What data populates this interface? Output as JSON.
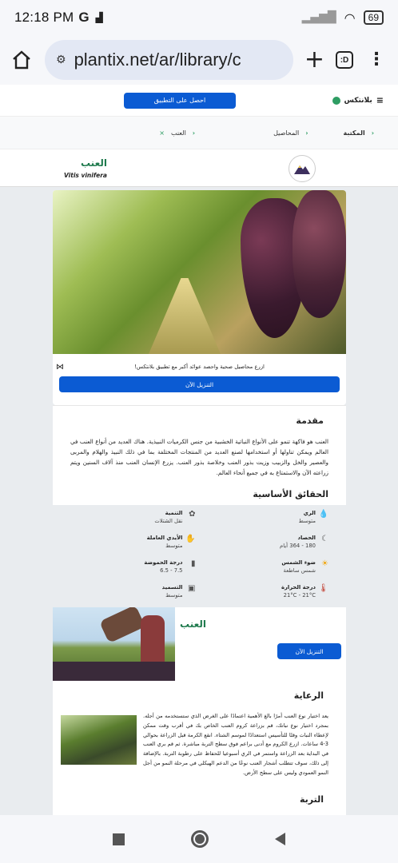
{
  "status_bar": {
    "time": "12:18 PM",
    "g": "G",
    "battery": "69"
  },
  "browser": {
    "url": "plantix.net/ar/library/c",
    "tabs_label": ":D"
  },
  "site_header": {
    "brand": "بلانتكس",
    "get_app": "احصل على التطبيق"
  },
  "breadcrumb": {
    "items": [
      "المكتبة",
      "المحاصيل",
      "العنب"
    ]
  },
  "crop": {
    "name": "العنب",
    "latin": "Vitis vinifera"
  },
  "promo": {
    "text": "ازرع محاصيل صحية واحصد عوائد أكبر مع تطبيق بلانتكس!",
    "button": "التنزيل الآن"
  },
  "intro": {
    "title": "مقدمة",
    "body": "العنب هو فاكهة تنمو على الأنواع النباتية الخشبية من جنس الكرميات النبيذية. هناك العديد من أنواع العنب في العالم ويمكن تناولها أو استخدامها لصنع العديد من المنتجات المختلفة بما في ذلك النبيذ والهلام والمربى والعصير والخل والزبيب وزيت بذور العنب وخلاصة بذور العنب. يزرع الإنسان العنب منذ آلاف السنين ويتم زراعته الآن والاستمتاع به في جميع أنحاء العالم."
  },
  "facts": {
    "title": "الحقائق الأساسية",
    "items": [
      {
        "icon": "water-drop-icon",
        "label": "الري",
        "value": "متوسط"
      },
      {
        "icon": "seedling-icon",
        "label": "التنمية",
        "value": "نقل الشتلات"
      },
      {
        "icon": "sickle-icon",
        "label": "الحصاد",
        "value": "180 - 364 أيام"
      },
      {
        "icon": "hand-icon",
        "label": "الأيدي العاملة",
        "value": "متوسط"
      },
      {
        "icon": "sun-icon",
        "label": "ضوء الشمس",
        "value": "شمس ساطعة"
      },
      {
        "icon": "ph-icon",
        "label": "درجة الحموضة",
        "value": "7.5 - 6.5"
      },
      {
        "icon": "thermometer-icon",
        "label": "درجة الحرارة",
        "value": "21°C - 21°C"
      },
      {
        "icon": "fertilizer-icon",
        "label": "التسميد",
        "value": "متوسط"
      }
    ]
  },
  "app_card": {
    "title": "العنب",
    "button": "التنزيل الآن"
  },
  "care": {
    "title": "الرعاية",
    "body": "يعد اختيار نوع العنب أمرًا بالغ الأهمية اعتمادًا على الغرض الذي ستستخدمه من أجله. بمجرد اختيار نوع نباتك، قم بزراعة كروم العنب الخاص بك في أقرب وقت ممكن لإعطاء النبات وقتًا للتأسيس استعدادًا لموسم الشتاء. انقع الكرمة قبل الزراعة بحوالي 3-4 ساعات. ازرع الكروم مع أدنى براعم فوق سطح التربة مباشرة. ثم قم بري العنب في البداية بعد الزراعة واستمر في الري أسبوعيا للحفاظ على رطوبة التربة. بالإضافة إلى ذلك، سوف تتطلب أشجار العنب نوعًا من الدعم الهيكلي في مرحلة النمو من أجل النمو العمودي وليس على سطح الأرض."
  },
  "soil": {
    "title": "التربة"
  },
  "colors": {
    "accent": "#0b5bd3",
    "brand_green": "#2e9d63",
    "facts_bg": "#e9ecef"
  }
}
